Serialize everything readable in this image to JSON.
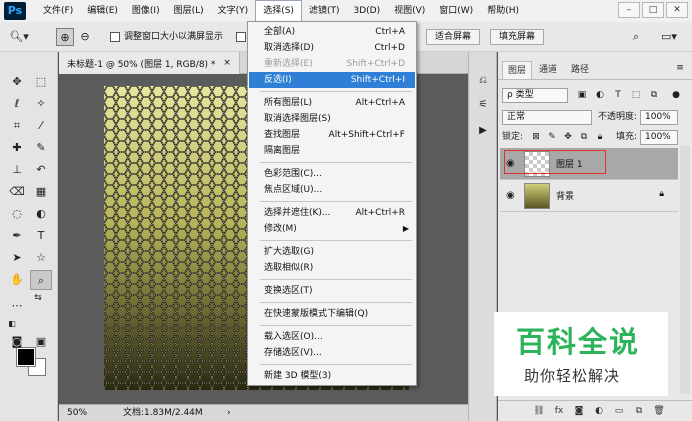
{
  "app": {
    "logo": "Ps"
  },
  "menubar": {
    "items": [
      {
        "label": "文件(F)"
      },
      {
        "label": "编辑(E)"
      },
      {
        "label": "图像(I)"
      },
      {
        "label": "图层(L)"
      },
      {
        "label": "文字(Y)"
      },
      {
        "label": "选择(S)"
      },
      {
        "label": "滤镜(T)"
      },
      {
        "label": "3D(D)"
      },
      {
        "label": "视图(V)"
      },
      {
        "label": "窗口(W)"
      },
      {
        "label": "帮助(H)"
      }
    ],
    "window_buttons": [
      "–",
      "□",
      "✕"
    ]
  },
  "options_bar": {
    "resize_windows_label": "调整窗口大小以满屏显示",
    "fit_screen_label": "适合屏幕",
    "fill_screen_label": "填充屏幕"
  },
  "document": {
    "tab_title": "未标题-1 @ 50% (图层 1, RGB/8) *",
    "tab_close": "×",
    "zoom": "50%",
    "doc_info": "文档:1.83M/2.44M"
  },
  "select_menu": {
    "items": [
      {
        "label": "全部(A)",
        "shortcut": "Ctrl+A"
      },
      {
        "label": "取消选择(D)",
        "shortcut": "Ctrl+D"
      },
      {
        "label": "重新选择(E)",
        "shortcut": "Shift+Ctrl+D",
        "disabled": true
      },
      {
        "label": "反选(I)",
        "shortcut": "Shift+Ctrl+I",
        "highlighted": true
      },
      {
        "label": "所有图层(L)",
        "shortcut": "Alt+Ctrl+A"
      },
      {
        "label": "取消选择图层(S)",
        "shortcut": ""
      },
      {
        "label": "查找图层",
        "shortcut": "Alt+Shift+Ctrl+F"
      },
      {
        "label": "隔离图层",
        "shortcut": ""
      },
      {
        "label": "色彩范围(C)...",
        "shortcut": ""
      },
      {
        "label": "焦点区域(U)...",
        "shortcut": ""
      },
      {
        "label": "选择并遮住(K)...",
        "shortcut": "Alt+Ctrl+R"
      },
      {
        "label": "修改(M)",
        "shortcut": ""
      },
      {
        "label": "扩大选取(G)",
        "shortcut": ""
      },
      {
        "label": "选取相似(R)",
        "shortcut": ""
      },
      {
        "label": "变换选区(T)",
        "shortcut": ""
      },
      {
        "label": "在快速蒙版模式下编辑(Q)",
        "shortcut": ""
      },
      {
        "label": "载入选区(O)...",
        "shortcut": ""
      },
      {
        "label": "存储选区(V)...",
        "shortcut": ""
      },
      {
        "label": "新建 3D 模型(3)",
        "shortcut": ""
      }
    ]
  },
  "layers_panel": {
    "tabs": [
      {
        "label": "图层"
      },
      {
        "label": "通道"
      },
      {
        "label": "路径"
      }
    ],
    "filter_kind": "ρ 类型",
    "blend_mode": "正常",
    "opacity_label": "不透明度:",
    "opacity_value": "100%",
    "lock_label": "锁定:",
    "fill_label": "填充:",
    "fill_value": "100%",
    "layers": [
      {
        "name": "图层 1",
        "selected": true
      },
      {
        "name": "背景",
        "locked": true
      }
    ]
  },
  "watermark": {
    "title": "百科全说",
    "subtitle": "助你轻松解决"
  },
  "colors": {
    "accent_highlight": "#2f7fd6",
    "annotation_red": "#e1312a",
    "watermark_green": "#2db45a"
  }
}
